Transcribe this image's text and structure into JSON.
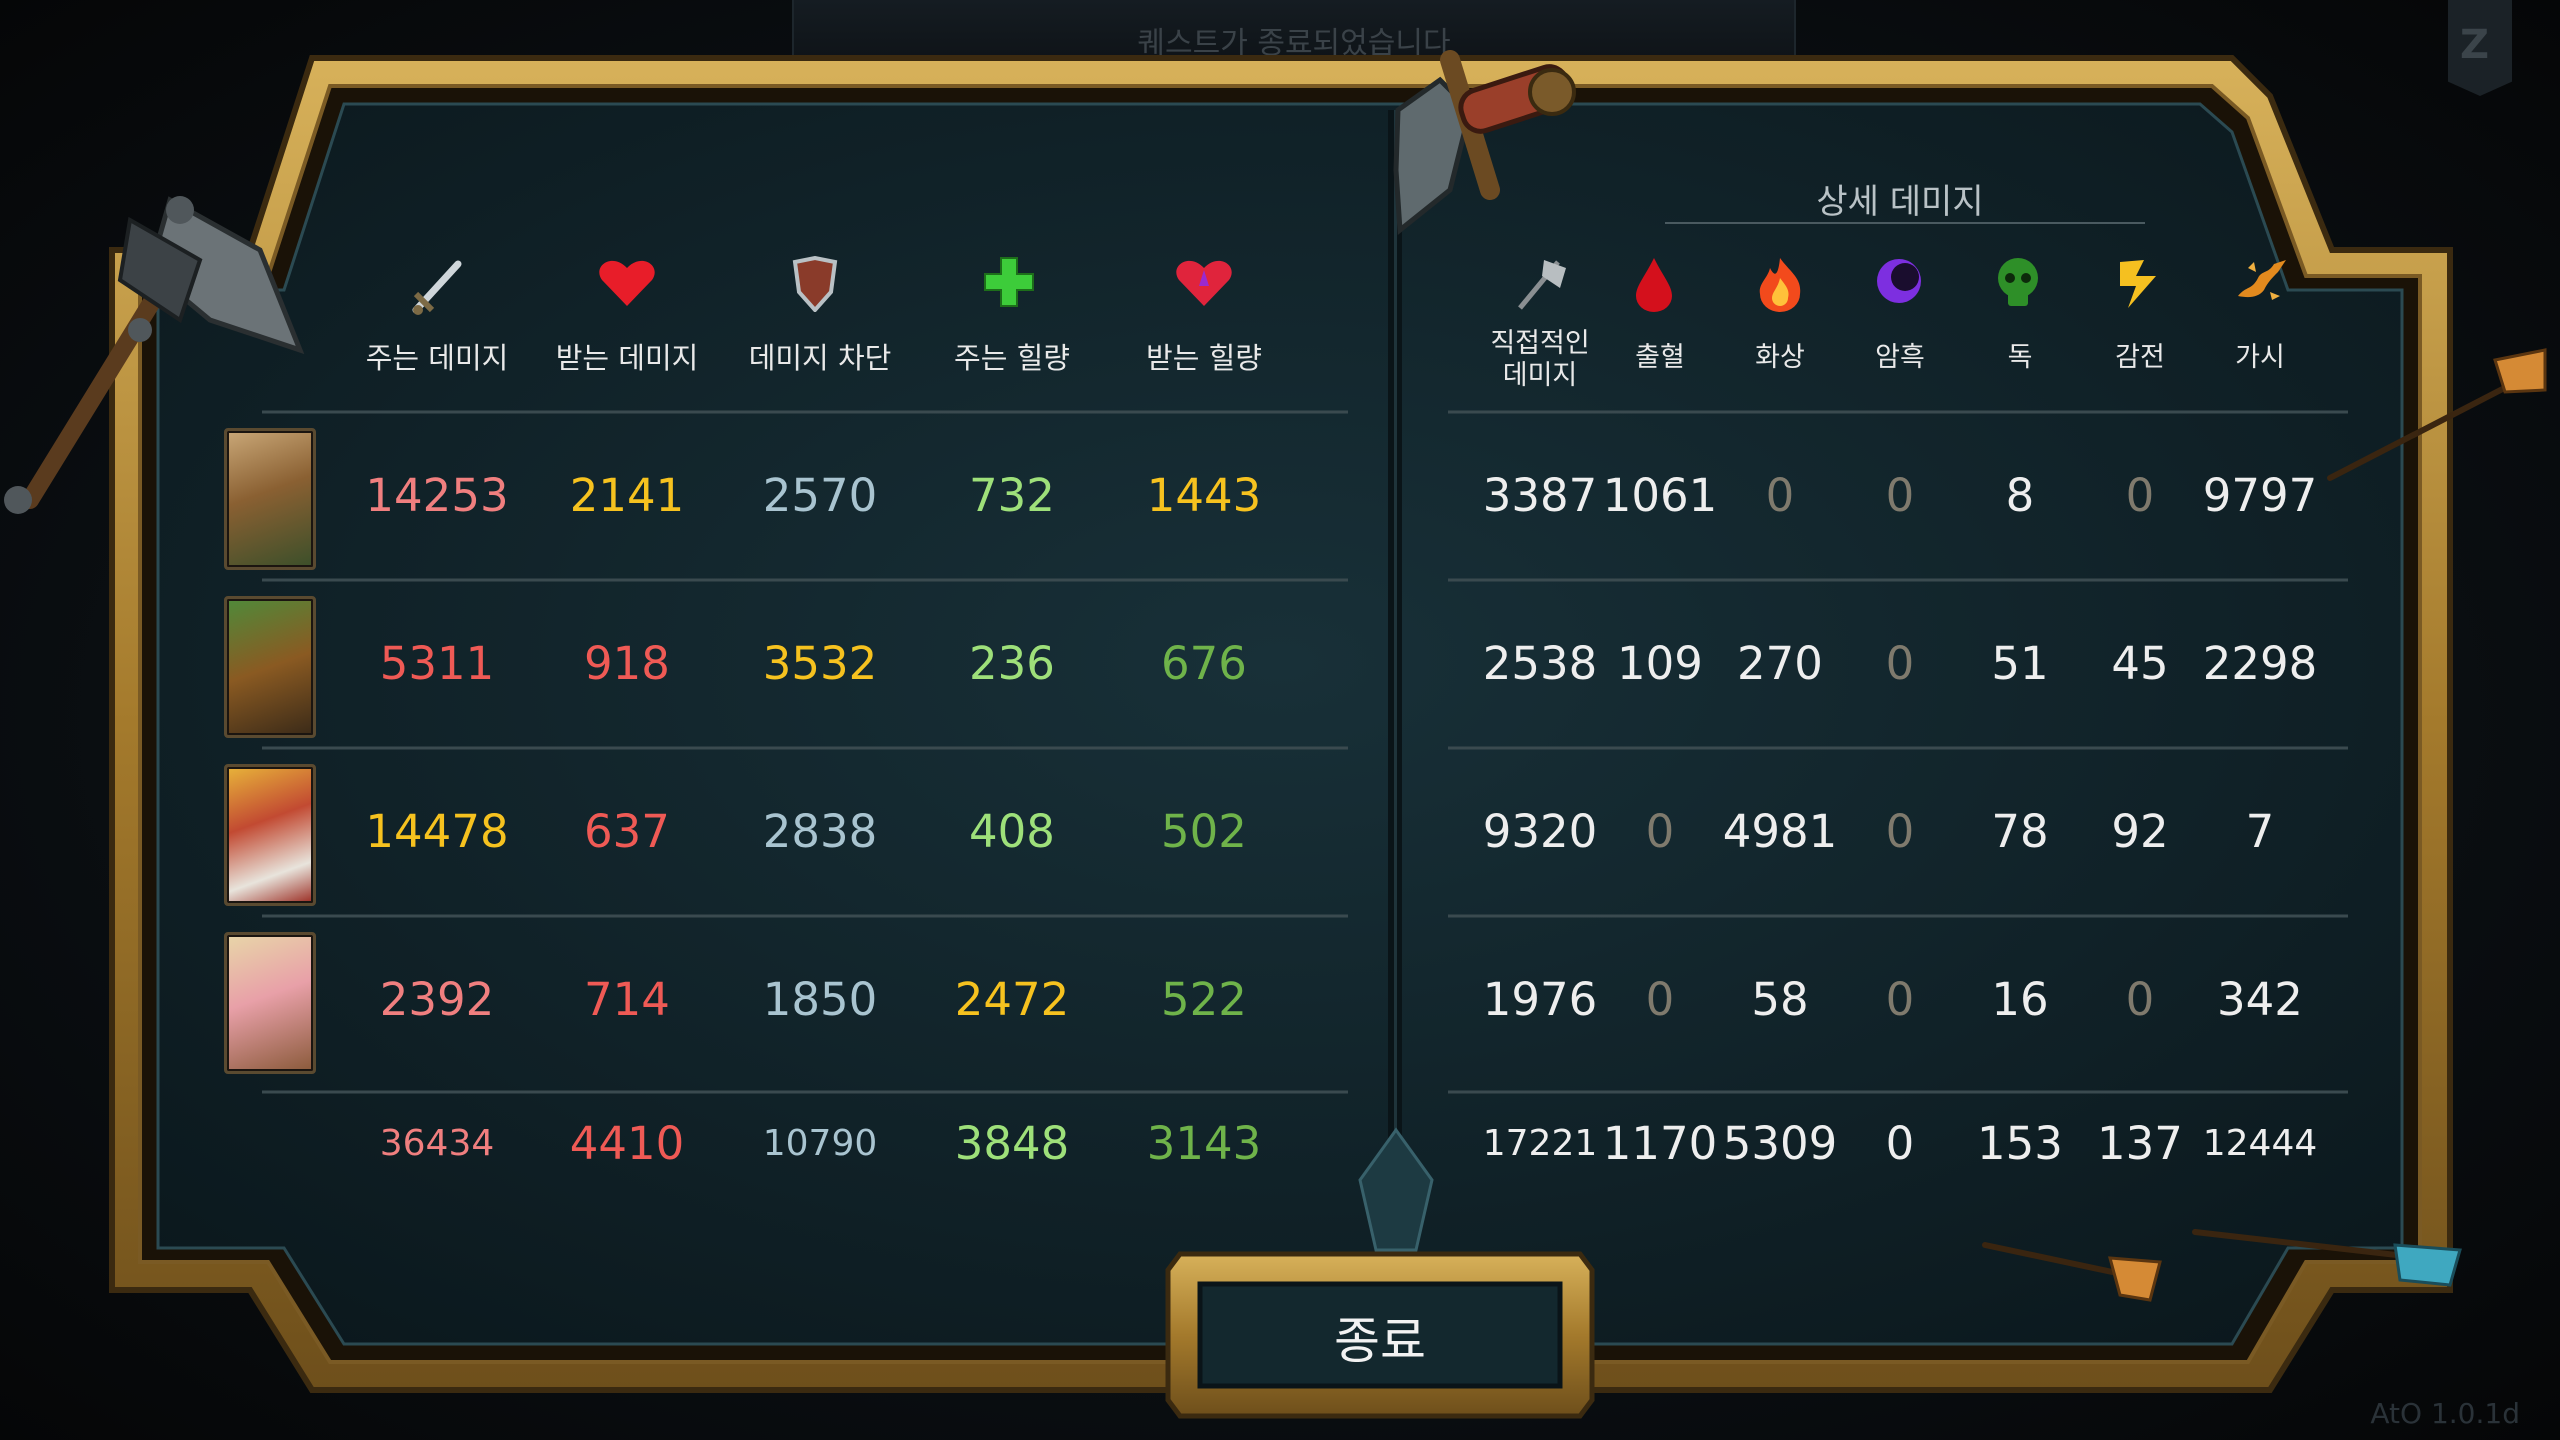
{
  "top_notice": "퀘스트가 종료되었습니다",
  "version": "AtO 1.0.1d",
  "corner_badge": "Z",
  "left_headers": [
    {
      "label": "주는 데미지",
      "icon": "sword-icon"
    },
    {
      "label": "받는 데미지",
      "icon": "heart-icon"
    },
    {
      "label": "데미지 차단",
      "icon": "shield-icon"
    },
    {
      "label": "주는 힐량",
      "icon": "plus-icon"
    },
    {
      "label": "받는 힐량",
      "icon": "healing-heart-icon"
    }
  ],
  "detail_title": "상세 데미지",
  "right_headers": [
    {
      "label": "직접적인\n데미지",
      "icon": "axe-icon"
    },
    {
      "label": "출혈",
      "icon": "blood-drop-icon"
    },
    {
      "label": "화상",
      "icon": "fire-icon"
    },
    {
      "label": "암흑",
      "icon": "dark-moon-icon"
    },
    {
      "label": "독",
      "icon": "poison-skull-icon"
    },
    {
      "label": "감전",
      "icon": "lightning-icon"
    },
    {
      "label": "가시",
      "icon": "thorns-icon"
    }
  ],
  "rows": [
    {
      "hero": "deer-hero-portrait",
      "left": [
        "14253",
        "2141",
        "2570",
        "732",
        "1443"
      ],
      "right": [
        "3387",
        "1061",
        "0",
        "0",
        "8",
        "0",
        "9797"
      ]
    },
    {
      "hero": "armored-hero-portrait",
      "left": [
        "5311",
        "918",
        "3532",
        "236",
        "676"
      ],
      "right": [
        "2538",
        "109",
        "270",
        "0",
        "51",
        "45",
        "2298"
      ]
    },
    {
      "hero": "dwarf-hero-portrait",
      "left": [
        "14478",
        "637",
        "2838",
        "408",
        "502"
      ],
      "right": [
        "9320",
        "0",
        "4981",
        "0",
        "78",
        "92",
        "7"
      ]
    },
    {
      "hero": "pig-hero-portrait",
      "left": [
        "2392",
        "714",
        "1850",
        "2472",
        "522"
      ],
      "right": [
        "1976",
        "0",
        "58",
        "0",
        "16",
        "0",
        "342"
      ]
    }
  ],
  "totals": {
    "left": [
      "36434",
      "4410",
      "10790",
      "3848",
      "3143"
    ],
    "right": [
      "17221",
      "1170",
      "5309",
      "0",
      "153",
      "137",
      "12444"
    ]
  },
  "end_button": "종료",
  "colors": {
    "frame_gold": "#b88f3a",
    "panel_bg": "#112329",
    "red": "#ef5a55",
    "pink": "#f07f7f",
    "yellow": "#f6c21f",
    "light_blue": "#a9c4d0",
    "green": "#9ee07a",
    "dark_green": "#6fb34a",
    "white": "#eeeeee",
    "muted": "#7f7a6d"
  }
}
